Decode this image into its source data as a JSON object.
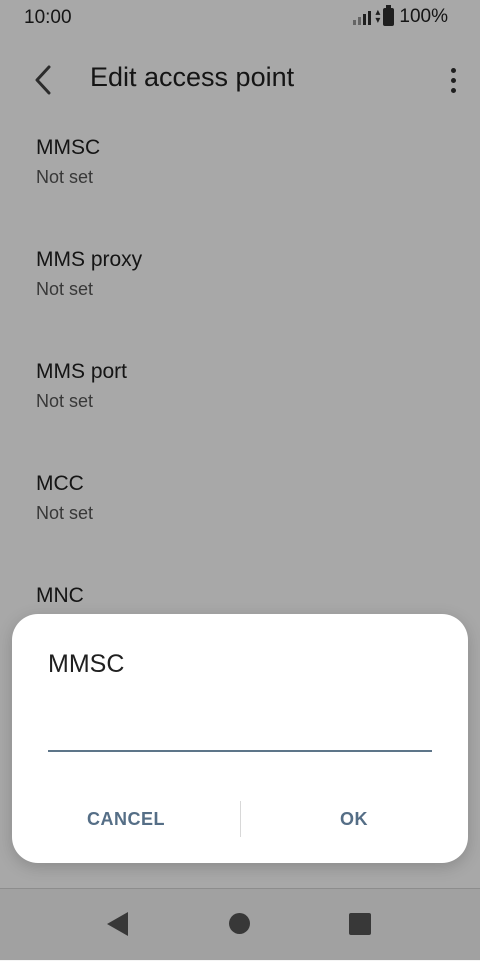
{
  "status_bar": {
    "time": "10:00",
    "battery": "100%"
  },
  "app_bar": {
    "title": "Edit access point"
  },
  "settings": [
    {
      "title": "MMSC",
      "summary": "Not set"
    },
    {
      "title": "MMS proxy",
      "summary": "Not set"
    },
    {
      "title": "MMS port",
      "summary": "Not set"
    },
    {
      "title": "MCC",
      "summary": "Not set"
    },
    {
      "title": "MNC",
      "summary": ""
    }
  ],
  "dialog": {
    "title": "MMSC",
    "input_value": "",
    "cancel_label": "CANCEL",
    "ok_label": "OK"
  },
  "colors": {
    "accent": "#556e86",
    "scrim": "rgba(0,0,0,0.34)"
  },
  "icons": {
    "back": "chevron-left-icon",
    "more": "more-vert-icon"
  }
}
